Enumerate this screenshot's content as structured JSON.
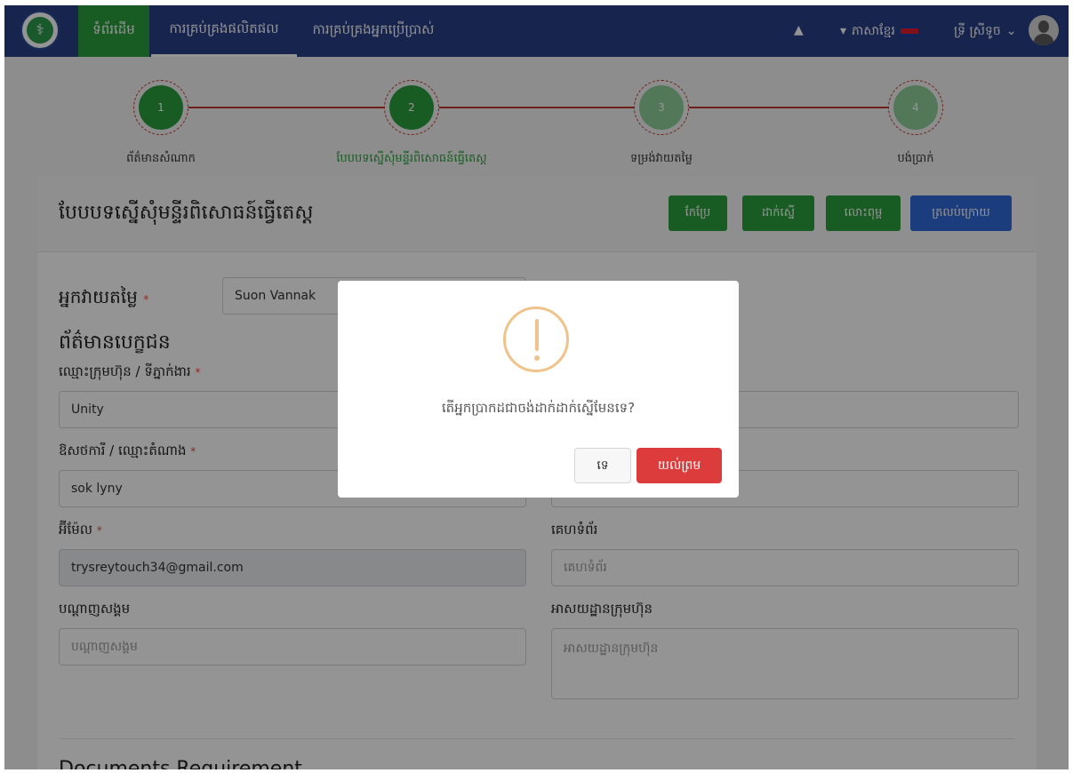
{
  "nav": {
    "home": "ទំព័រដើម",
    "product_mgmt": "ការគ្រប់គ្រងផលិតផល",
    "user_mgmt": "ការគ្រប់គ្រងអ្នកប្រើប្រាស់",
    "language": "ភាសាខ្មែរ",
    "username": "ទ្រី ស្រីទូច"
  },
  "stepper": {
    "steps": [
      {
        "number": "1",
        "label": "ព័ត៌មានសំណាក",
        "status": "done"
      },
      {
        "number": "2",
        "label": "បែបបទស្នើសុំមន្ទីរពិសោធន៍ធ្វើតេស្ត",
        "status": "active"
      },
      {
        "number": "3",
        "label": "ទម្រង់វាយតម្លៃ",
        "status": "todo"
      },
      {
        "number": "4",
        "label": "បង់ប្រាក់",
        "status": "todo"
      }
    ]
  },
  "form": {
    "title": "បែបបទស្នើសុំមន្ទីរពិសោធន៍ធ្វើតេស្ត",
    "buttons": {
      "edit": "កែប្រែ",
      "submit": "ដាក់ស្នើ",
      "delete": "លោះពុម្ព",
      "back": "ត្រលប់ក្រោយ"
    },
    "assessor": {
      "label": "អ្នកវាយតម្លៃ",
      "value": "Suon Vannak"
    },
    "client_section": "ព័ត៌មានបេក្ខជន",
    "company": {
      "label": "ឈ្មោះក្រុមហ៊ុន / ទីភ្នាក់ងារ",
      "value": "Unity"
    },
    "representative": {
      "label": "ឱសថការី / ឈ្មោះតំណាង",
      "value": "sok lyny"
    },
    "email": {
      "label": "អ៊ីម៉ែល",
      "value": "trysreytouch34@gmail.com"
    },
    "website": {
      "label": "គេហទំព័រ",
      "placeholder": "គេហទំព័រ"
    },
    "social": {
      "label": "បណ្តាញសង្គម",
      "placeholder": "បណ្តាញសង្គម"
    },
    "address": {
      "label": "អាសយដ្ឋានក្រុមហ៊ុន",
      "placeholder": "អាសយដ្ឋានក្រុមហ៊ុន"
    },
    "documents_heading": "Documents Requirement"
  },
  "dialog": {
    "message": "តើអ្នកប្រាកដជាចង់ដាក់ដាក់ស្នើមែនទេ?",
    "cancel": "ទេ",
    "confirm": "យល់ព្រម"
  },
  "colors": {
    "navbar": "#283e87",
    "primary_green": "#2a9f3d",
    "primary_blue": "#2f6ad8",
    "danger": "#dc3c3c",
    "warning": "#f0c38a"
  }
}
